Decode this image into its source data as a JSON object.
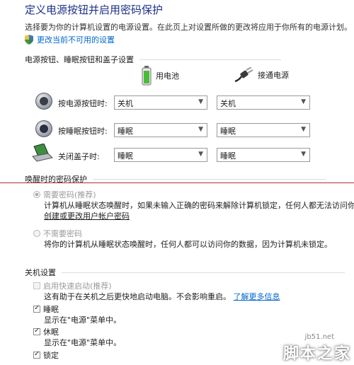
{
  "header": {
    "title": "定义电源按钮并启用密码保护",
    "subtitle": "选择要为你的计算机设置的电源设置。在此页上对设置所做的更改将应用于你所有的电源计划。",
    "shield_link": "更改当前不可用的设置"
  },
  "buttons_section": {
    "title": "电源按钮、睡眠按钮和盖子设置",
    "col_battery": "用电池",
    "col_plugged": "接通电源",
    "rows": [
      {
        "label": "按电源按钮时:",
        "battery": "关机",
        "plugged": "关机"
      },
      {
        "label": "按睡眠按钮时:",
        "battery": "睡眠",
        "plugged": "睡眠"
      },
      {
        "label": "关闭盖子时:",
        "battery": "睡眠",
        "plugged": "睡眠"
      }
    ]
  },
  "password_section": {
    "title": "唤醒时的密码保护",
    "opt1_label": "需要密码(推荐)",
    "opt1_desc": "计算机从睡眠状态唤醒时，如果未输入正确的密码来解除计算机锁定，任何人都无法访问你的数",
    "opt1_link": "创建或更改用户帐户密码",
    "opt2_label": "不需要密码",
    "opt2_desc": "将你的计算机从睡眠状态唤醒时，任何人都可以访问你的数据，因为计算机未锁定。"
  },
  "shutdown_section": {
    "title": "关机设置",
    "fast_label": "启用快速启动(推荐)",
    "fast_desc": "这有助于在关机之后更快地启动电脑。不会影响重启。",
    "fast_link": "了解更多信息",
    "sleep_label": "睡眠",
    "sleep_desc": "显示在\"电源\"菜单中。",
    "hibernate_label": "休眠",
    "hibernate_desc": "显示在\"电源\"菜单中。",
    "lock_label": "锁定"
  },
  "watermark": {
    "site": "jb51.net",
    "brand": "脚本之家"
  }
}
